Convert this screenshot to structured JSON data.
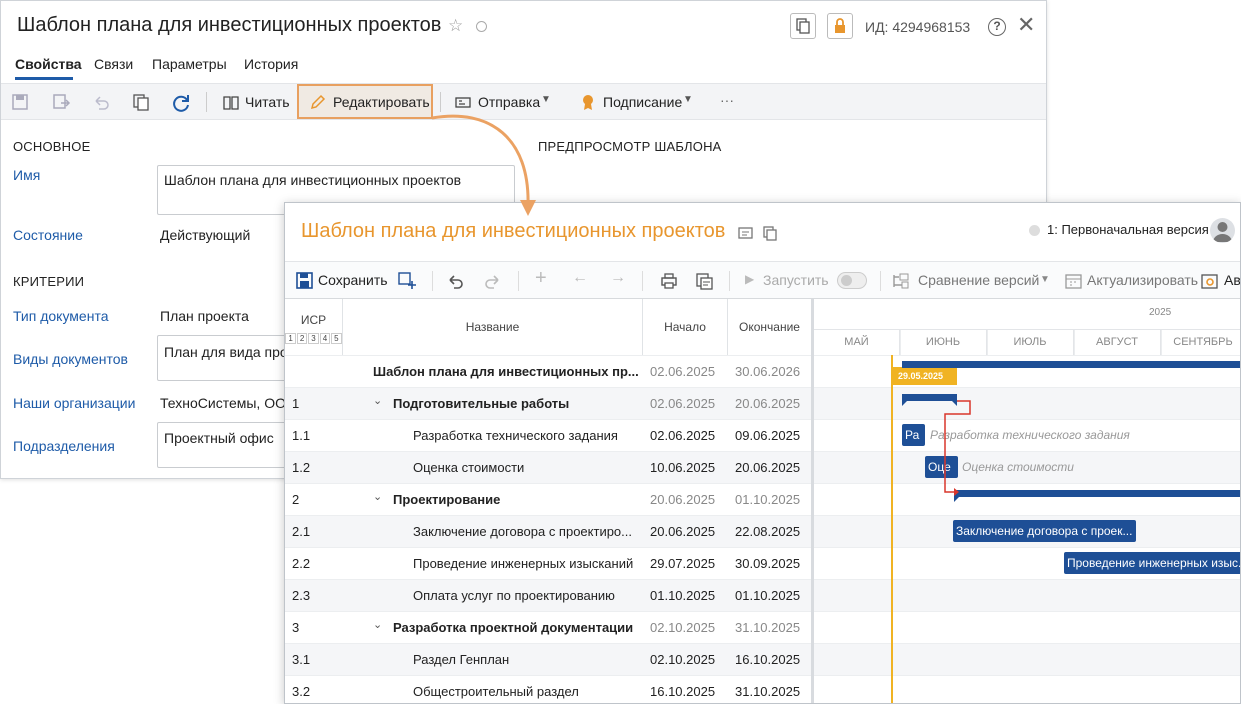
{
  "card": {
    "title": "Шаблон плана для инвестиционных проектов",
    "id_label": "ИД: 4294968153",
    "tabs": [
      "Свойства",
      "Связи",
      "Параметры",
      "История"
    ],
    "toolbar": {
      "read": "Читать",
      "edit": "Редактировать",
      "send": "Отправка",
      "sign": "Подписание",
      "more": "···"
    },
    "section_main": "ОСНОВНОЕ",
    "section_preview": "ПРЕДПРОСМОТР ШАБЛОНА",
    "section_criteria": "КРИТЕРИИ",
    "fields": {
      "name_label": "Имя",
      "name_value": "Шаблон плана для инвестиционных проектов",
      "state_label": "Состояние",
      "state_value": "Действующий",
      "doctype_label": "Тип документа",
      "doctype_value": "План проекта",
      "kinds_label": "Виды документов",
      "kinds_value": "План для вида про",
      "orgs_label": "Наши организации",
      "orgs_value": "ТехноСистемы, ООО",
      "dept_label": "Подразделения",
      "dept_value": "Проектный офис"
    }
  },
  "plan": {
    "title": "Шаблон плана для инвестиционных проектов",
    "version": "1: Первоначальная версия",
    "toolbar": {
      "save": "Сохранить",
      "run": "Запустить",
      "compare": "Сравнение версий",
      "update": "Актуализировать",
      "auto": "Авт"
    },
    "columns": {
      "wbs": "ИСР",
      "levels": [
        "1",
        "2",
        "3",
        "4",
        "5"
      ],
      "name": "Название",
      "start": "Начало",
      "end": "Окончание"
    },
    "rows": [
      {
        "wbs": "",
        "name": "Шаблон плана для инвестиционных пр...",
        "start": "02.06.2025",
        "end": "30.06.2026"
      },
      {
        "wbs": "1",
        "name": "Подготовительные работы",
        "start": "02.06.2025",
        "end": "20.06.2025"
      },
      {
        "wbs": "1.1",
        "name": "Разработка технического задания",
        "start": "02.06.2025",
        "end": "09.06.2025"
      },
      {
        "wbs": "1.2",
        "name": "Оценка стоимости",
        "start": "10.06.2025",
        "end": "20.06.2025"
      },
      {
        "wbs": "2",
        "name": "Проектирование",
        "start": "20.06.2025",
        "end": "01.10.2025"
      },
      {
        "wbs": "2.1",
        "name": "Заключение договора с проектиро...",
        "start": "20.06.2025",
        "end": "22.08.2025"
      },
      {
        "wbs": "2.2",
        "name": "Проведение инженерных изысканий",
        "start": "29.07.2025",
        "end": "30.09.2025"
      },
      {
        "wbs": "2.3",
        "name": "Оплата услуг по проектированию",
        "start": "01.10.2025",
        "end": "01.10.2025"
      },
      {
        "wbs": "3",
        "name": "Разработка проектной документации",
        "start": "02.10.2025",
        "end": "31.10.2025"
      },
      {
        "wbs": "3.1",
        "name": "Раздел Генплан",
        "start": "02.10.2025",
        "end": "16.10.2025"
      },
      {
        "wbs": "3.2",
        "name": "Общестроительный раздел",
        "start": "16.10.2025",
        "end": "31.10.2025"
      }
    ],
    "gantt": {
      "year": "2025",
      "months": [
        "МАЙ",
        "ИЮНЬ",
        "ИЮЛЬ",
        "АВГУСТ",
        "СЕНТЯБРЬ"
      ],
      "today": "29.05.2025",
      "bar_labels": {
        "r11": "Ра",
        "r11_out": "Разработка технического задания",
        "r12": "Оце",
        "r12_out": "Оценка стоимости",
        "r21": "Заключение договора с проек...",
        "r22": "Проведение инженерных изыс..."
      }
    }
  }
}
